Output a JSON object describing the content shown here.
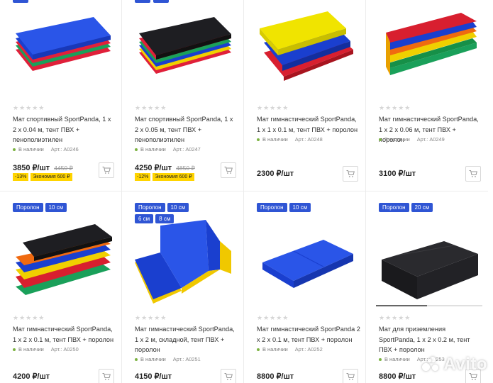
{
  "products": [
    {
      "title": "Мат спортивный SportPanda, 1 x 2 x 0.04 м, тент ПВХ + пенополиэтилен",
      "availability": "В наличии",
      "sku": "Арт.: А0246",
      "price": "3850 ₽/шт",
      "old_price": "4450 ₽",
      "discount": "-13%",
      "savings": "Экономия 600 ₽",
      "tags": []
    },
    {
      "title": "Мат спортивный SportPanda, 1 x 2 x 0.05 м, тент ПВХ + пенополиэтилен",
      "availability": "В наличии",
      "sku": "Арт.: А0247",
      "price": "4250 ₽/шт",
      "old_price": "4850 ₽",
      "discount": "-12%",
      "savings": "Экономия 600 ₽",
      "tags": []
    },
    {
      "title": "Мат гимнастический SportPanda, 1 x 1 x 0.1 м, тент ПВХ + поролон",
      "availability": "В наличии",
      "sku": "Арт.: А0248",
      "price": "2300 ₽/шт",
      "tags": []
    },
    {
      "title": "Мат гимнастический SportPanda, 1 x 2 x 0.06 м, тент ПВХ + поролон",
      "availability": "В наличии",
      "sku": "Арт.: А0249",
      "price": "3100 ₽/шт",
      "tags": []
    },
    {
      "title": "Мат гимнастический SportPanda, 1 x 2 x 0.1 м, тент ПВХ + поролон",
      "availability": "В наличии",
      "sku": "Арт.: А0250",
      "price": "4200 ₽/шт",
      "tags": [
        "Поролон",
        "10 см"
      ]
    },
    {
      "title": "Мат гимнастический SportPanda, 1 x 2 м, складной, тент ПВХ + поролон",
      "availability": "В наличии",
      "sku": "Арт.: А0251",
      "price": "4150 ₽/шт",
      "tags": [
        "Поролон",
        "10 см",
        "6 см",
        "8 см"
      ]
    },
    {
      "title": "Мат гимнастический SportPanda 2 x 2 x 0.1 м, тент ПВХ + поролон",
      "availability": "В наличии",
      "sku": "Арт.: А0252",
      "price": "8800 ₽/шт",
      "tags": [
        "Поролон",
        "10 см"
      ]
    },
    {
      "title": "Мат для приземления SportPanda, 1 x 2 x 0.2 м, тент ПВХ + поролон",
      "availability": "В наличии",
      "sku": "Арт.: А0253",
      "price": "8800 ₽/шт",
      "tags": [
        "Поролон",
        "20 см"
      ],
      "gallery_progress": 0.48
    }
  ],
  "stars": "★★★★★",
  "watermark": "Avito",
  "icons": {
    "cart": "cart-icon",
    "availability": "in-stock-dot-icon"
  },
  "colors": {
    "tag_bg": "#2f55d4",
    "discount_bg": "#ffd400",
    "in_stock": "#7cb342"
  }
}
